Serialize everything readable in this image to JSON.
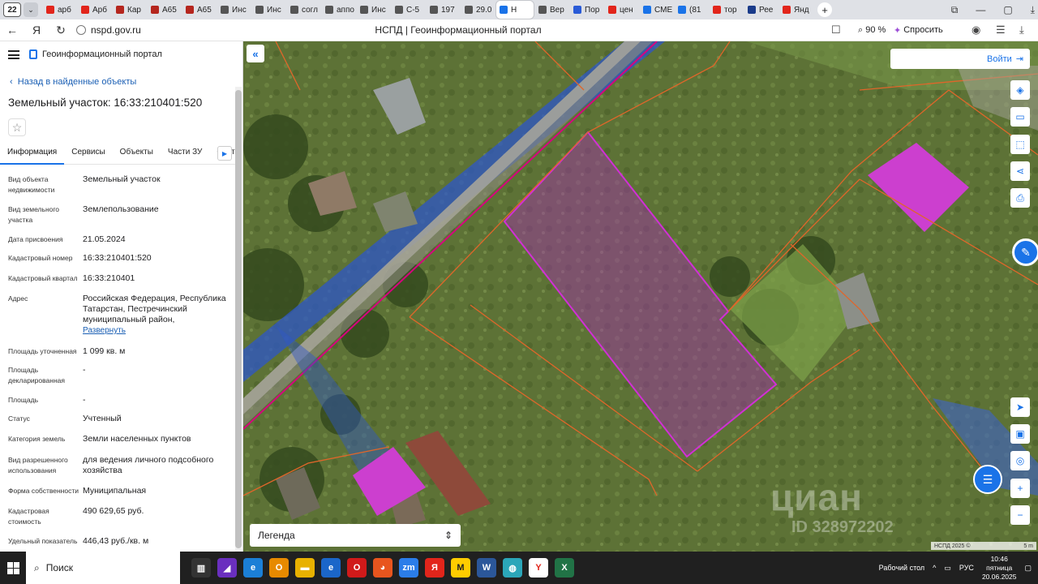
{
  "browser": {
    "tab_count": "22",
    "tabs": [
      {
        "label": "арб",
        "color": "#e2251b"
      },
      {
        "label": "Арб",
        "color": "#e2251b"
      },
      {
        "label": "Кар",
        "color": "#b5261e"
      },
      {
        "label": "А65",
        "color": "#b5261e"
      },
      {
        "label": "А65",
        "color": "#b5261e"
      },
      {
        "label": "Инс",
        "color": "#555555"
      },
      {
        "label": "Инс",
        "color": "#555555"
      },
      {
        "label": "согл",
        "color": "#555555"
      },
      {
        "label": "аппо",
        "color": "#555555"
      },
      {
        "label": "Инс",
        "color": "#555555"
      },
      {
        "label": "С-5",
        "color": "#555555"
      },
      {
        "label": "197",
        "color": "#555555"
      },
      {
        "label": "29.0",
        "color": "#555555"
      },
      {
        "label": "Н",
        "color": "#1a73e8",
        "active": true
      },
      {
        "label": "Вер",
        "color": "#555555"
      },
      {
        "label": "Пор",
        "color": "#2a5bd7"
      },
      {
        "label": "цен",
        "color": "#e2251b"
      },
      {
        "label": "СМЕ",
        "color": "#1a73e8"
      },
      {
        "label": "(81",
        "color": "#1a73e8"
      },
      {
        "label": "тор",
        "color": "#e2251b"
      },
      {
        "label": "Рее",
        "color": "#1a3b8a"
      },
      {
        "label": "Янд",
        "color": "#e2251b"
      }
    ],
    "url": "nspd.gov.ru",
    "page_title": "НСПД | Геоинформационный портал",
    "zoom": "90 %",
    "ask_label": "Спросить"
  },
  "panel": {
    "portal_name": "Геоинформационный портал",
    "back_link": "Назад в найденные объекты",
    "title": "Земельный участок: 16:33:210401:520",
    "tabs": [
      "Информация",
      "Сервисы",
      "Объекты",
      "Части ЗУ",
      "Сост"
    ],
    "properties": [
      {
        "label": "Вид объекта недвижимости",
        "value": "Земельный участок"
      },
      {
        "label": "Вид земельного участка",
        "value": "Землепользование"
      },
      {
        "label": "Дата присвоения",
        "value": "21.05.2024"
      },
      {
        "label": "Кадастровый номер",
        "value": "16:33:210401:520"
      },
      {
        "label": "Кадастровый квартал",
        "value": "16:33:210401"
      },
      {
        "label": "Адрес",
        "value": "Российская Федерация, Республика Татарстан, Пестречинский муниципальный район,",
        "more": "Развернуть"
      },
      {
        "label": "Площадь уточненная",
        "value": "1 099 кв. м"
      },
      {
        "label": "Площадь декларированная",
        "value": "-"
      },
      {
        "label": "Площадь",
        "value": "-"
      },
      {
        "label": "Статус",
        "value": "Учтенный"
      },
      {
        "label": "Категория земель",
        "value": "Земли населенных пунктов"
      },
      {
        "label": "Вид разрешенного использования",
        "value": "для ведения личного подсобного хозяйства"
      },
      {
        "label": "Форма собственности",
        "value": "Муниципальная"
      },
      {
        "label": "Кадастровая стоимость",
        "value": "490 629,65 руб."
      },
      {
        "label": "Удельный показатель",
        "value": "446,43 руб./кв. м"
      }
    ]
  },
  "map": {
    "login_label": "Войти",
    "legend_label": "Легенда",
    "watermark": "циан",
    "watermark_id": "ID 328972202",
    "attribution": "НСПД 2025 ©",
    "scale": "5 m"
  },
  "taskbar": {
    "search_label": "Поиск",
    "desktop_label": "Рабочий стол",
    "language": "РУС",
    "time": "10:46",
    "weekday": "пятница",
    "date": "20.06.2025"
  }
}
